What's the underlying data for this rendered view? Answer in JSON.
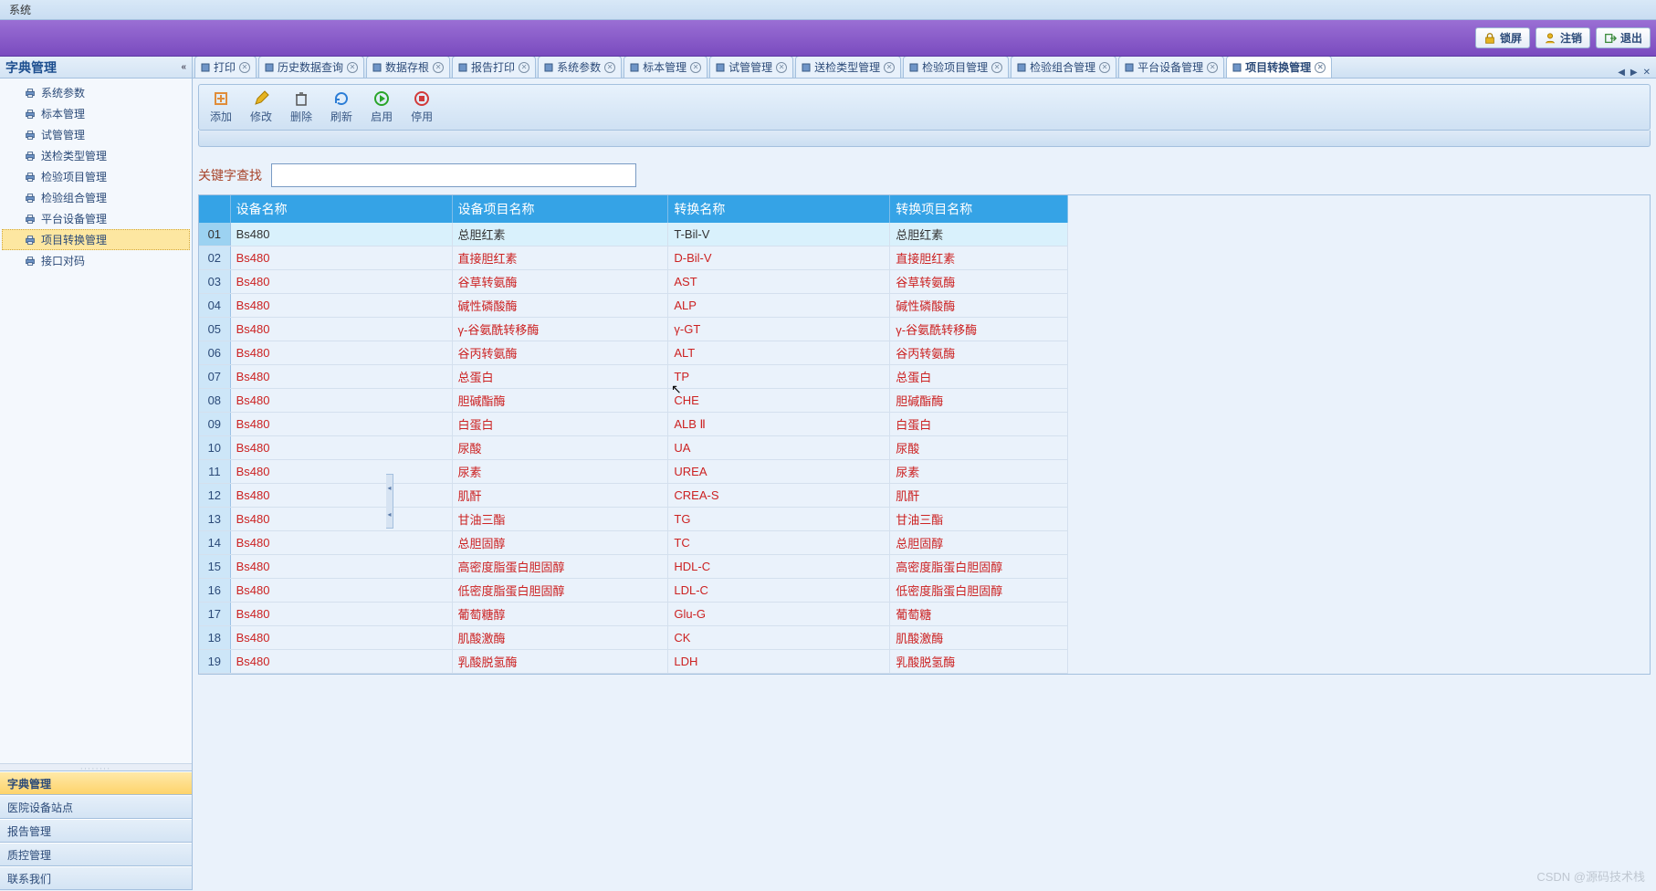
{
  "title": "系统",
  "ribbon_buttons": {
    "lock": "锁屏",
    "logout": "注销",
    "exit": "退出"
  },
  "sidebar": {
    "header": "字典管理",
    "items": [
      {
        "label": "系统参数"
      },
      {
        "label": "标本管理"
      },
      {
        "label": "试管管理"
      },
      {
        "label": "送检类型管理"
      },
      {
        "label": "检验项目管理"
      },
      {
        "label": "检验组合管理"
      },
      {
        "label": "平台设备管理"
      },
      {
        "label": "项目转换管理",
        "selected": true
      },
      {
        "label": "接口对码"
      }
    ],
    "nav_groups": [
      {
        "label": "字典管理",
        "active": true
      },
      {
        "label": "医院设备站点"
      },
      {
        "label": "报告管理"
      },
      {
        "label": "质控管理"
      },
      {
        "label": "联系我们"
      }
    ]
  },
  "tabs": [
    {
      "label": "打印"
    },
    {
      "label": "历史数据查询"
    },
    {
      "label": "数据存根"
    },
    {
      "label": "报告打印"
    },
    {
      "label": "系统参数"
    },
    {
      "label": "标本管理"
    },
    {
      "label": "试管管理"
    },
    {
      "label": "送检类型管理"
    },
    {
      "label": "检验项目管理"
    },
    {
      "label": "检验组合管理"
    },
    {
      "label": "平台设备管理"
    },
    {
      "label": "项目转换管理",
      "active": true
    }
  ],
  "toolbar": [
    {
      "name": "add",
      "label": "添加"
    },
    {
      "name": "edit",
      "label": "修改"
    },
    {
      "name": "delete",
      "label": "删除"
    },
    {
      "name": "refresh",
      "label": "刷新"
    },
    {
      "name": "enable",
      "label": "启用"
    },
    {
      "name": "disable",
      "label": "停用"
    }
  ],
  "search": {
    "label": "关键字查找",
    "value": ""
  },
  "table": {
    "columns": [
      "设备名称",
      "设备项目名称",
      "转换名称",
      "转换项目名称"
    ],
    "rows": [
      {
        "n": "01",
        "device": "Bs480",
        "proj": "总胆红素",
        "conv": "T-Bil-V",
        "convproj": "总胆红素",
        "sel": true
      },
      {
        "n": "02",
        "device": "Bs480",
        "proj": "直接胆红素",
        "conv": "D-Bil-V",
        "convproj": "直接胆红素"
      },
      {
        "n": "03",
        "device": "Bs480",
        "proj": "谷草转氨酶",
        "conv": "AST",
        "convproj": "谷草转氨酶"
      },
      {
        "n": "04",
        "device": "Bs480",
        "proj": "碱性磷酸酶",
        "conv": "ALP",
        "convproj": "碱性磷酸酶"
      },
      {
        "n": "05",
        "device": "Bs480",
        "proj": "γ-谷氨酰转移酶",
        "conv": "γ-GT",
        "convproj": "γ-谷氨酰转移酶"
      },
      {
        "n": "06",
        "device": "Bs480",
        "proj": "谷丙转氨酶",
        "conv": "ALT",
        "convproj": "谷丙转氨酶"
      },
      {
        "n": "07",
        "device": "Bs480",
        "proj": "总蛋白",
        "conv": "TP",
        "convproj": "总蛋白"
      },
      {
        "n": "08",
        "device": "Bs480",
        "proj": "胆碱酯酶",
        "conv": "CHE",
        "convproj": "胆碱酯酶"
      },
      {
        "n": "09",
        "device": "Bs480",
        "proj": "白蛋白",
        "conv": "ALB Ⅱ",
        "convproj": "白蛋白"
      },
      {
        "n": "10",
        "device": "Bs480",
        "proj": "尿酸",
        "conv": "UA",
        "convproj": "尿酸"
      },
      {
        "n": "11",
        "device": "Bs480",
        "proj": "尿素",
        "conv": "UREA",
        "convproj": "尿素"
      },
      {
        "n": "12",
        "device": "Bs480",
        "proj": "肌酐",
        "conv": "CREA-S",
        "convproj": "肌酐"
      },
      {
        "n": "13",
        "device": "Bs480",
        "proj": "甘油三酯",
        "conv": "TG",
        "convproj": "甘油三酯"
      },
      {
        "n": "14",
        "device": "Bs480",
        "proj": "总胆固醇",
        "conv": "TC",
        "convproj": "总胆固醇"
      },
      {
        "n": "15",
        "device": "Bs480",
        "proj": "高密度脂蛋白胆固醇",
        "conv": "HDL-C",
        "convproj": "高密度脂蛋白胆固醇"
      },
      {
        "n": "16",
        "device": "Bs480",
        "proj": "低密度脂蛋白胆固醇",
        "conv": "LDL-C",
        "convproj": "低密度脂蛋白胆固醇"
      },
      {
        "n": "17",
        "device": "Bs480",
        "proj": "葡萄糖醇",
        "conv": "Glu-G",
        "convproj": "葡萄糖"
      },
      {
        "n": "18",
        "device": "Bs480",
        "proj": "肌酸激酶",
        "conv": "CK",
        "convproj": "肌酸激酶"
      },
      {
        "n": "19",
        "device": "Bs480",
        "proj": "乳酸脱氢酶",
        "conv": "LDH",
        "convproj": "乳酸脱氢酶"
      }
    ]
  },
  "watermark": "CSDN @源码技术栈"
}
